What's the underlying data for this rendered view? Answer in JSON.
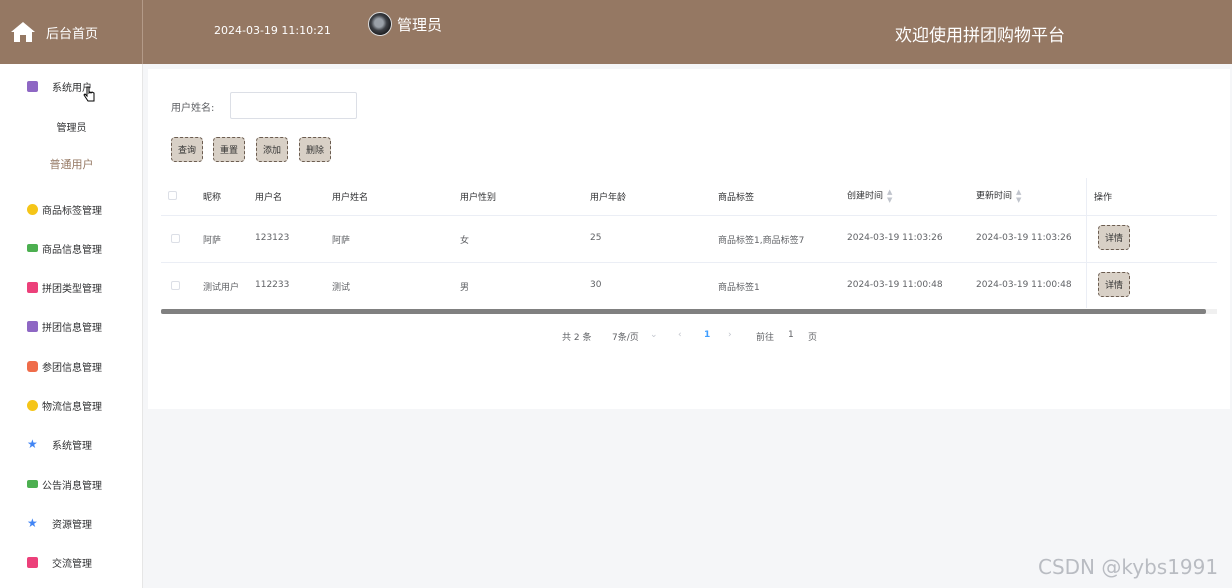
{
  "header": {
    "brand_label": "后台首页",
    "datetime": "2024-03-19 11:10:21",
    "admin_label": "管理员",
    "welcome": "欢迎使用拼团购物平台",
    "bg_color": "#957863"
  },
  "sidebar": {
    "items": [
      {
        "label": "系统用户",
        "icon": "archive-icon",
        "color": "#8e67c4"
      },
      {
        "label": "商品标签管理",
        "icon": "badge-icon",
        "color": "#f5c518"
      },
      {
        "label": "商品信息管理",
        "icon": "message-icon",
        "color": "#4caf50"
      },
      {
        "label": "拼团类型管理",
        "icon": "ticket-icon",
        "color": "#ec407a"
      },
      {
        "label": "拼团信息管理",
        "icon": "archive-icon",
        "color": "#8e67c4"
      },
      {
        "label": "参团信息管理",
        "icon": "grid-icon",
        "color": "#ef6c4a"
      },
      {
        "label": "物流信息管理",
        "icon": "badge-icon",
        "color": "#f5c518"
      },
      {
        "label": "系统管理",
        "icon": "star-icon",
        "color": "#4285f4"
      },
      {
        "label": "公告消息管理",
        "icon": "message-icon",
        "color": "#4caf50"
      },
      {
        "label": "资源管理",
        "icon": "star-icon",
        "color": "#4285f4"
      },
      {
        "label": "交流管理",
        "icon": "ticket-icon",
        "color": "#ec407a"
      }
    ],
    "sub_items": [
      "管理员",
      "普通用户"
    ]
  },
  "search": {
    "label": "用户姓名:",
    "value": "",
    "placeholder": ""
  },
  "toolbar": {
    "query_label": "查询",
    "reset_label": "重置",
    "add_label": "添加",
    "delete_label": "删除"
  },
  "table": {
    "columns": [
      "昵称",
      "用户名",
      "用户姓名",
      "用户性别",
      "用户年龄",
      "商品标签",
      "创建时间",
      "更新时间",
      "操作"
    ],
    "rows": [
      {
        "nickname": "阿萨",
        "username": "123123",
        "realname": "阿萨",
        "gender": "女",
        "age": "25",
        "tags": "商品标签1,商品标签7",
        "created": "2024-03-19 11:03:26",
        "updated": "2024-03-19 11:03:26",
        "action": "详情"
      },
      {
        "nickname": "测试用户",
        "username": "112233",
        "realname": "测试",
        "gender": "男",
        "age": "30",
        "tags": "商品标签1",
        "created": "2024-03-19 11:00:48",
        "updated": "2024-03-19 11:00:48",
        "action": "详情"
      }
    ]
  },
  "pagination": {
    "total": "共 2 条",
    "page_size": "7条/页",
    "current": "1",
    "goto_label": "前往",
    "goto_value": "1",
    "page_suffix": "页"
  },
  "watermark": "CSDN @kybs1991"
}
